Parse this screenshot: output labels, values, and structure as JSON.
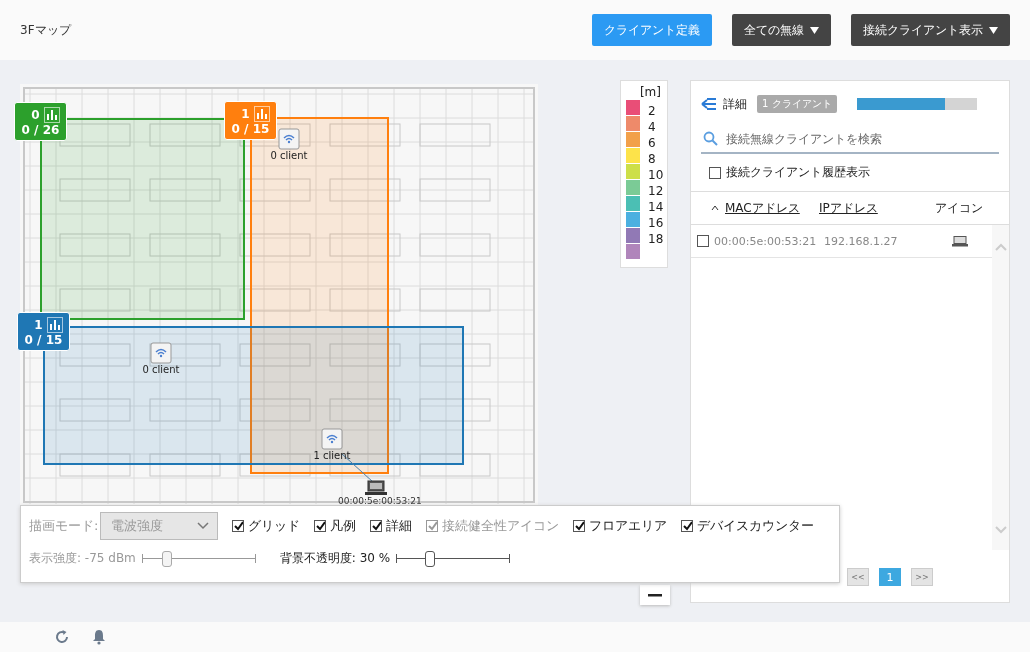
{
  "header": {
    "title": "3Fマップ",
    "buttons": [
      {
        "label": "クライアント定義",
        "kind": "primary"
      },
      {
        "label": "全ての無線",
        "kind": "dropdown"
      },
      {
        "label": "接続クライアント表示",
        "kind": "dropdown"
      }
    ]
  },
  "map": {
    "areas": [
      {
        "color": "#2ca02c",
        "count": "0",
        "capacity": "0 / 26"
      },
      {
        "color": "#ff7f0e",
        "count": "1",
        "capacity": "0 / 15"
      },
      {
        "color": "#1f77b4",
        "count": "1",
        "capacity": "0 / 15"
      }
    ],
    "access_points": [
      {
        "label": "0 client"
      },
      {
        "label": "0 client"
      },
      {
        "label": "1 client"
      }
    ],
    "client_label": "00:00:5e:00:53:21"
  },
  "legend": {
    "unit": "[m]",
    "items": [
      {
        "color": "#e94e77",
        "label": "2"
      },
      {
        "color": "#ee8a6a",
        "label": "4"
      },
      {
        "color": "#f2a04a",
        "label": "6"
      },
      {
        "color": "#fde34a",
        "label": "8"
      },
      {
        "color": "#cddf48",
        "label": "10"
      },
      {
        "color": "#7bcb96",
        "label": "12"
      },
      {
        "color": "#4bbfb4",
        "label": "14"
      },
      {
        "color": "#4bb0e0",
        "label": "16"
      },
      {
        "color": "#9179b5",
        "label": "18"
      },
      {
        "color": "#b085bb"
      }
    ]
  },
  "details": {
    "title": "詳細",
    "badge": "1 クライアント",
    "level": 0.74,
    "search": {
      "placeholder": "接続無線クライアントを検索"
    },
    "history": {
      "label": "接続クライアント履歴表示",
      "checked": false
    },
    "columns": [
      {
        "label": "MACアドレス",
        "sorted": true
      },
      {
        "label": "IPアドレス",
        "sorted": false
      },
      {
        "label": "アイコン",
        "sorted": false
      }
    ],
    "rows": [
      {
        "checked": false,
        "mac": "00:00:5e:00:53:21",
        "ip": "192.168.1.27"
      }
    ],
    "pagination": {
      "prev": "<<",
      "pages": [
        {
          "label": "1",
          "selected": true
        }
      ],
      "next": ">>"
    }
  },
  "options": {
    "mode_label": "描画モード:",
    "mode_value": "電波強度",
    "mode_disabled": true,
    "checkboxes": [
      {
        "label": "グリッド",
        "checked": true,
        "disabled": false
      },
      {
        "label": "凡例",
        "checked": true,
        "disabled": false
      },
      {
        "label": "詳細",
        "checked": true,
        "disabled": false
      },
      {
        "label": "接続健全性アイコン",
        "checked": true,
        "disabled": true
      },
      {
        "label": "フロアエリア",
        "checked": true,
        "disabled": false
      },
      {
        "label": "デバイスカウンター",
        "checked": true,
        "disabled": false
      }
    ],
    "sliders": [
      {
        "label": "表示強度: -75 dBm",
        "level": 0.22,
        "disabled": true
      },
      {
        "label": "背景不透明度: 30 %",
        "level": 0.3,
        "disabled": false
      }
    ]
  }
}
